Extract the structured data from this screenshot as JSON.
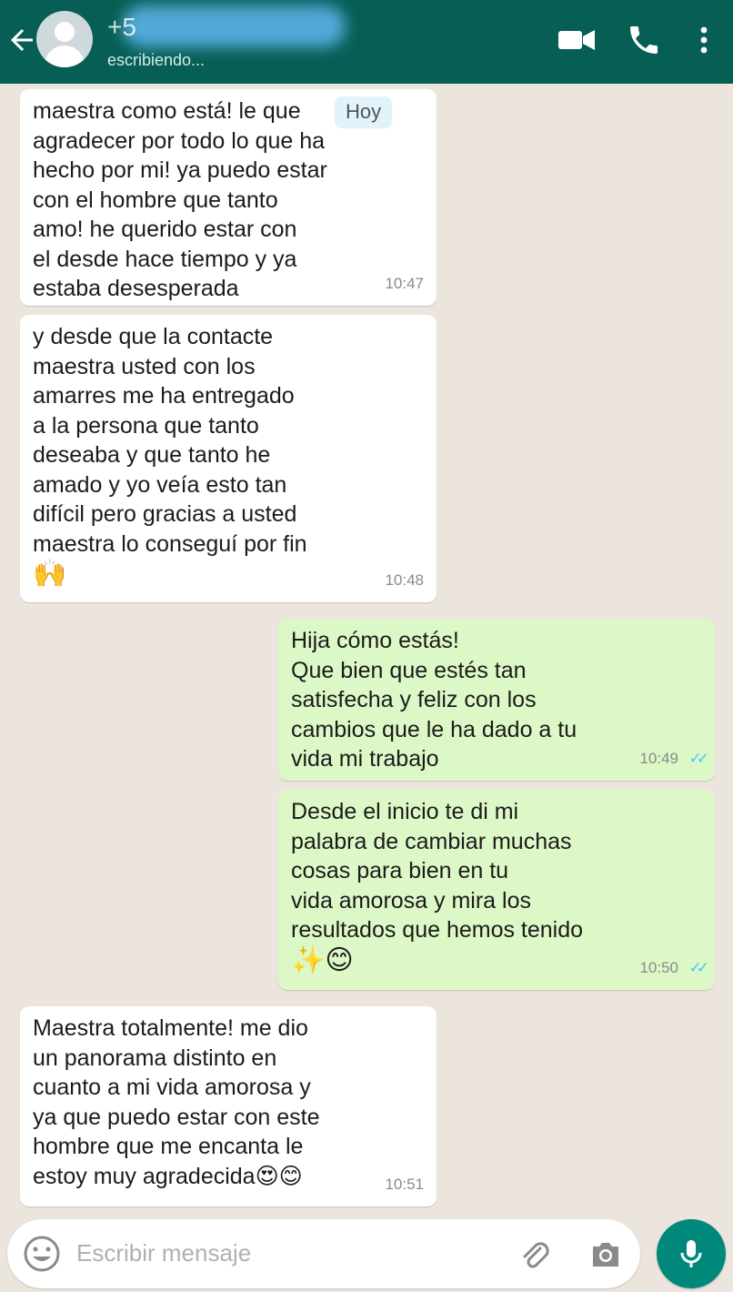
{
  "header": {
    "contact_name": "+5",
    "status": "escribiendo...",
    "icons": [
      "back-arrow-icon",
      "avatar",
      "video-call-icon",
      "phone-icon",
      "more-options-icon"
    ],
    "color": "#075e54"
  },
  "day_chip": "Hoy",
  "messages": [
    {
      "direction": "incoming",
      "text": "maestra como está! le que\nagradecer por todo lo que ha\nhecho por mi! ya puedo estar\ncon el hombre que tanto\namo! he querido estar con\nel desde hace tiempo y ya\nestaba desesperada",
      "time": "10:47"
    },
    {
      "direction": "incoming",
      "text": "y desde que la contacte\nmaestra usted con los\namarres me ha entregado\na la persona que tanto\ndeseaba y que tanto he\namado y yo veía esto tan\ndifícil pero gracias a usted\nmaestra lo conseguí por fin",
      "emoji": "🙌",
      "time": "10:48"
    },
    {
      "direction": "outgoing",
      "text": "Hija cómo estás!\nQue bien que estés tan\nsatisfecha y feliz con los\ncambios que le ha dado a tu\nvida mi trabajo",
      "time": "10:49",
      "read": "✓✓"
    },
    {
      "direction": "outgoing",
      "text": "Desde el inicio te di mi\npalabra de cambiar muchas\ncosas para bien en tu\nvida amorosa y mira los\nresultados que hemos tenido",
      "emoji": "✨😊",
      "time": "10:50",
      "read": "✓✓"
    },
    {
      "direction": "incoming",
      "text": "Maestra totalmente! me dio\nun panorama distinto en\ncuanto a mi vida amorosa y\nya que puedo estar con este\nhombre que me encanta le\nestoy muy agradecida😍😊",
      "time": "10:51"
    }
  ],
  "composer": {
    "placeholder": "Escribir mensaje",
    "icons": [
      "emoji-icon",
      "attach-icon",
      "camera-icon",
      "mic-icon"
    ],
    "send_color": "#00897b"
  },
  "colors": {
    "incoming_bubble": "#ffffff",
    "outgoing_bubble": "#dcf8c6",
    "chat_background": "#ece5dd",
    "read_ticks": "#4fc3f7"
  }
}
